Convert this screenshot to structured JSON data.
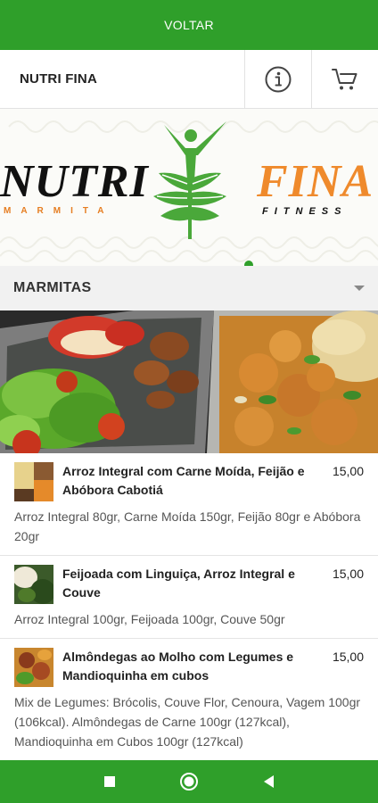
{
  "topbar": {
    "back_label": "VOLTAR"
  },
  "header": {
    "store_name": "NUTRI FINA",
    "info_icon": "info-icon",
    "cart_icon": "cart-icon"
  },
  "banner": {
    "logo_left": "NUTRI",
    "logo_left_sub": "MARMITA",
    "logo_right": "FINA",
    "logo_right_sub": "FITNESS"
  },
  "category": {
    "label": "MARMITAS",
    "icon": "dropdown-caret-icon"
  },
  "products": [
    {
      "title": "Arroz Integral com Carne Moída, Feijão e Abóbora Cabotiá",
      "price": "15,00",
      "description": "Arroz Integral 80gr, Carne Moída 150gr, Feijão 80gr e Abóbora 20gr"
    },
    {
      "title": "Feijoada com Linguiça, Arroz Integral e Couve",
      "price": "15,00",
      "description": "Arroz Integral 100gr, Feijoada 100gr, Couve 50gr"
    },
    {
      "title": "Almôndegas ao Molho com Legumes e Mandioquinha em cubos",
      "price": "15,00",
      "description": "Mix de Legumes: Brócolis, Couve Flor, Cenoura, Vagem 100gr (106kcal). Almôndegas de Carne 100gr (127kcal), Mandioquinha em Cubos 100gr (127kcal)"
    }
  ],
  "navbar": {
    "icons": [
      "recent-apps-icon",
      "home-icon",
      "back-icon"
    ]
  },
  "colors": {
    "brand_green": "#2f9f2a",
    "accent_orange": "#ef8a2c"
  }
}
